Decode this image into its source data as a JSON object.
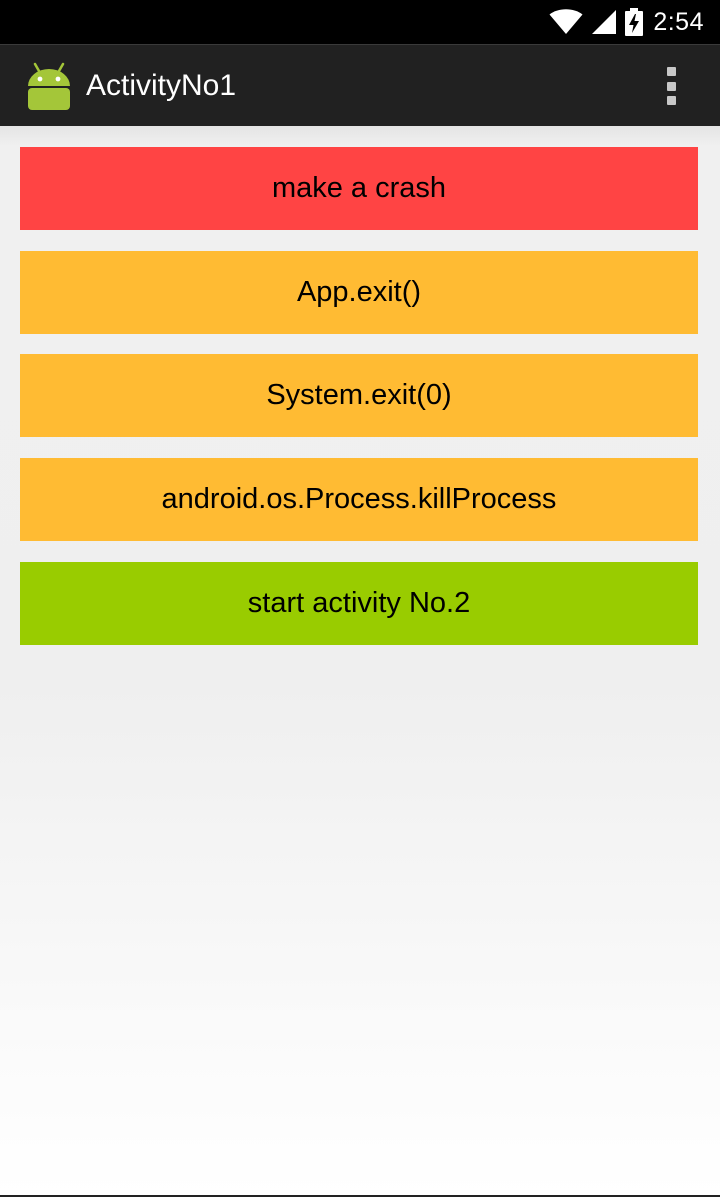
{
  "status_bar": {
    "time": "2:54",
    "icons": [
      "wifi-icon",
      "cell-signal-icon",
      "battery-charging-icon"
    ]
  },
  "action_bar": {
    "app_icon": "android-robot-icon",
    "title": "ActivityNo1",
    "menu_icon": "overflow-menu-icon"
  },
  "buttons": [
    {
      "label": "make a crash",
      "color": "#ff4444"
    },
    {
      "label": "App.exit()",
      "color": "#ffbb33"
    },
    {
      "label": "System.exit(0)",
      "color": "#ffbb33"
    },
    {
      "label": "android.os.Process.killProcess",
      "color": "#ffbb33"
    },
    {
      "label": "start activity No.2",
      "color": "#99cc00"
    }
  ],
  "colors": {
    "action_bar_bg": "#212121",
    "android_green": "#a4c639"
  }
}
